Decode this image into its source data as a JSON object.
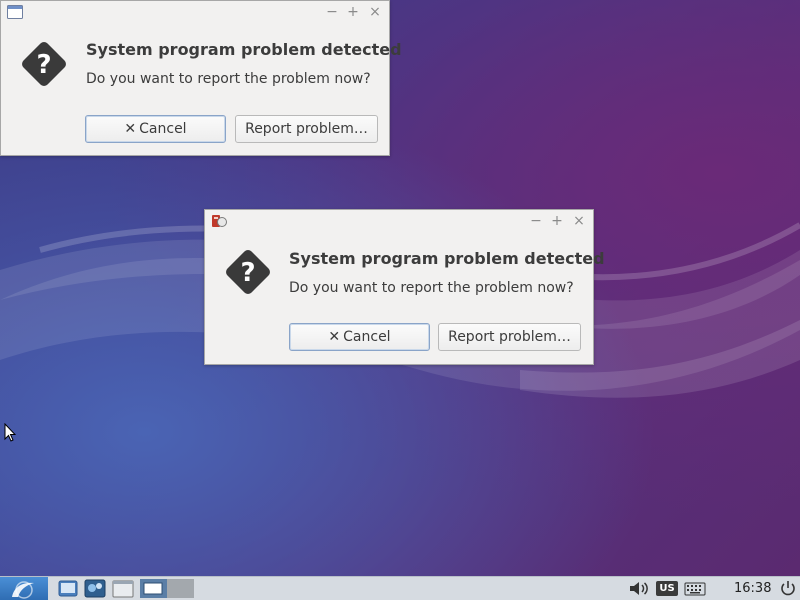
{
  "dialogs": [
    {
      "heading": "System program problem detected",
      "message": "Do you want to report the problem now?",
      "cancel_label": "Cancel",
      "report_label": "Report problem…",
      "window_buttons": {
        "minimize": "−",
        "maximize": "+",
        "close": "×"
      }
    },
    {
      "heading": "System program problem detected",
      "message": "Do you want to report the problem now?",
      "cancel_label": "Cancel",
      "report_label": "Report problem…",
      "window_buttons": {
        "minimize": "−",
        "maximize": "+",
        "close": "×"
      }
    }
  ],
  "taskbar": {
    "keyboard_layout": "US",
    "clock": "16:38",
    "icons": [
      "start-menu-icon",
      "show-desktop-icon",
      "app-launcher-icon",
      "file-manager-icon",
      "window-button-icon",
      "volume-icon",
      "keyboard-layout-icon",
      "on-screen-keyboard-icon",
      "power-icon"
    ]
  },
  "colors": {
    "accent": "#4a8fd6",
    "dialog_bg": "#f2f1f0",
    "text": "#3c3c3c",
    "taskbar_bg": "#d6dbe1"
  }
}
